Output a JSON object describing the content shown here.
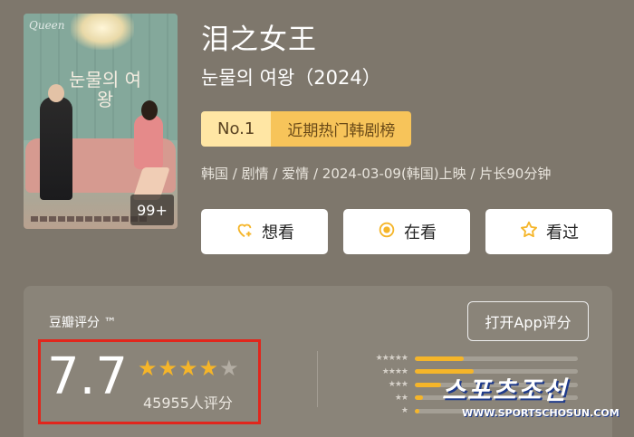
{
  "poster": {
    "badge": "99+",
    "title_text": "눈물의 여왕",
    "script_text": "Queen"
  },
  "header": {
    "title": "泪之女王",
    "subtitle": "눈물의 여왕（2024）",
    "rank_no": "No.1",
    "rank_label": "近期热门韩剧榜",
    "meta": "韩国 / 剧情 / 爱情 / 2024-03-09(韩国)上映 / 片长90分钟"
  },
  "actions": [
    {
      "label": "想看",
      "icon": "heart-plus-icon"
    },
    {
      "label": "在看",
      "icon": "target-circle-icon"
    },
    {
      "label": "看过",
      "icon": "star-outline-icon"
    }
  ],
  "rating": {
    "brand": "豆瓣评分 ™",
    "app_button": "打开App评分",
    "score": "7.7",
    "stars_filled": 4,
    "stars_total": 5,
    "count": "45955人评分",
    "distribution": [
      {
        "stars": 5,
        "fraction": 0.3
      },
      {
        "stars": 4,
        "fraction": 0.36
      },
      {
        "stars": 3,
        "fraction": 0.16
      },
      {
        "stars": 2,
        "fraction": 0.05
      },
      {
        "stars": 1,
        "fraction": 0.03
      }
    ]
  },
  "watermark": {
    "korean": "스포츠조선",
    "url": "WWW.SPORTSCHOSUN.COM"
  },
  "colors": {
    "background": "#7e776c",
    "card": "#8a8479",
    "star": "#f5b529",
    "highlight_border": "#e1261c",
    "rank_no_bg": "#ffe6a4",
    "rank_label_bg": "#f7c45a"
  }
}
